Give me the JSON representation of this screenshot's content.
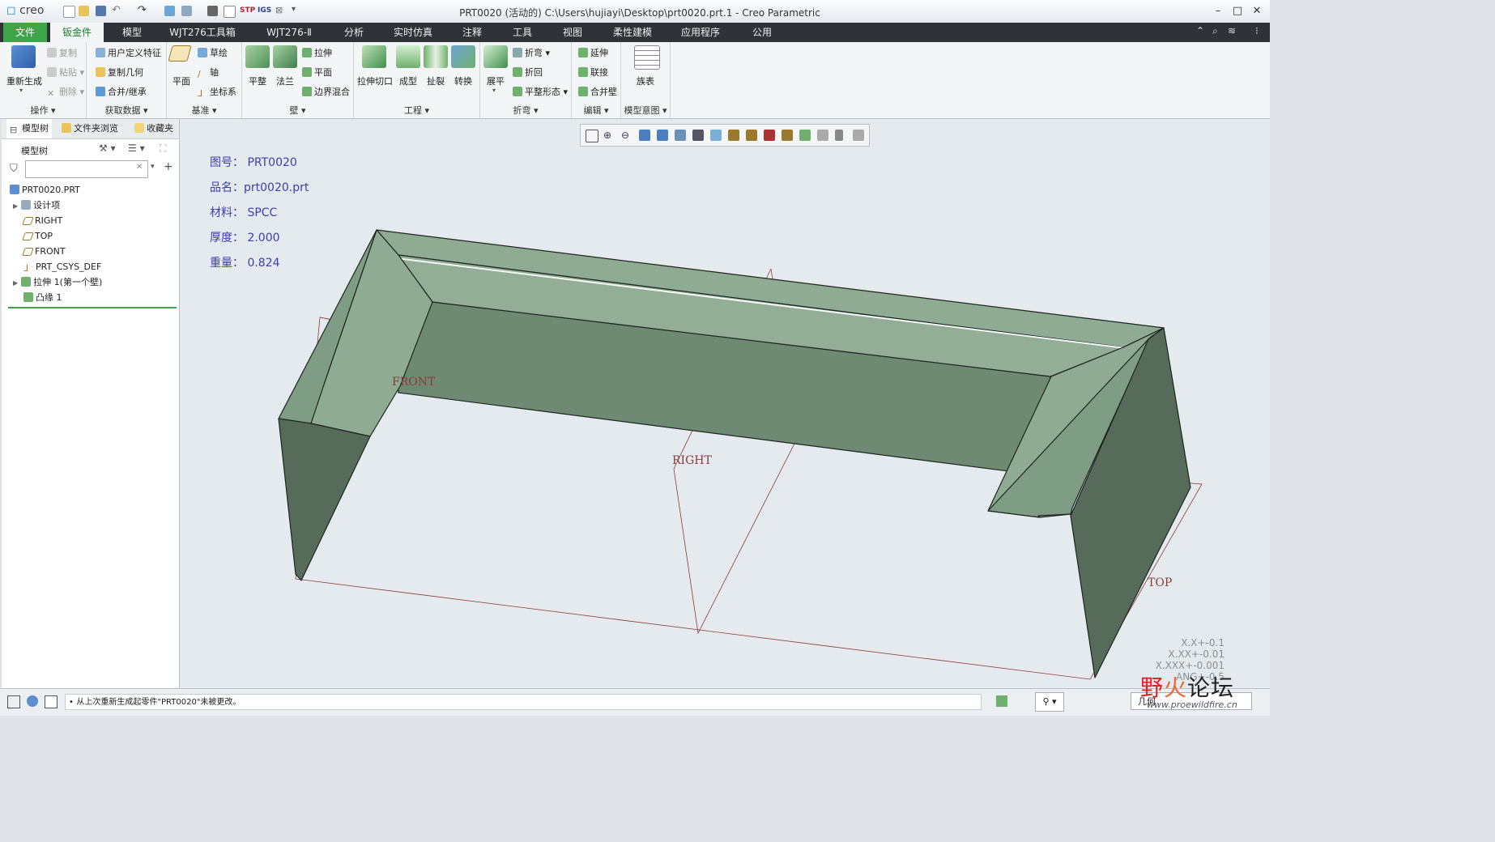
{
  "app": {
    "logo": "creo",
    "window_title": "PRT0020 (活动的) C:\\Users\\hujiayi\\Desktop\\prt0020.prt.1 - Creo Parametric"
  },
  "colors": {
    "accent": "#3ea549",
    "tab_dark": "#2f3338",
    "model_fill": "#8fab94",
    "model_dark": "#5a6e5f",
    "datum": "#8a3b3b",
    "note_text": "#3d3dab"
  },
  "tabs": [
    "文件",
    "钣金件",
    "模型",
    "WJT276工具箱",
    "WJT276-Ⅱ",
    "分析",
    "实时仿真",
    "注释",
    "工具",
    "视图",
    "柔性建模",
    "应用程序",
    "公用"
  ],
  "active_tab": "钣金件",
  "ribbon": {
    "groups": [
      {
        "label": "操作",
        "big": "重新生成",
        "small": [
          "复制",
          "粘贴",
          "删除"
        ]
      },
      {
        "label": "获取数据",
        "small": [
          "用户定义特征",
          "复制几何",
          "合并/继承"
        ]
      },
      {
        "label": "基准",
        "big": "平面",
        "small": [
          "草绘",
          "轴",
          "坐标系"
        ]
      },
      {
        "label": "壁",
        "bigs": [
          "平整",
          "法兰"
        ],
        "small": [
          "拉伸",
          "平面",
          "边界混合"
        ]
      },
      {
        "label": "工程",
        "bigs": [
          "拉伸切口",
          "成型",
          "扯裂",
          "转换"
        ]
      },
      {
        "label": "折弯",
        "big": "展平",
        "small": [
          "折弯",
          "折回",
          "平整形态"
        ]
      },
      {
        "label": "编辑",
        "small": [
          "延伸",
          "联接",
          "合并壁"
        ]
      },
      {
        "label": "模型意图",
        "big": "族表"
      }
    ]
  },
  "panel": {
    "tabs": [
      "模型树",
      "文件夹浏览器",
      "收藏夹"
    ],
    "tree_header": "模型树",
    "tree": [
      {
        "label": "PRT0020.PRT",
        "level": 0
      },
      {
        "label": "设计项",
        "level": 1
      },
      {
        "label": "RIGHT",
        "level": 1
      },
      {
        "label": "TOP",
        "level": 1
      },
      {
        "label": "FRONT",
        "level": 1
      },
      {
        "label": "PRT_CSYS_DEF",
        "level": 1
      },
      {
        "label": "拉伸 1(第一个壁)",
        "level": 1
      },
      {
        "label": "凸缘 1",
        "level": 1
      }
    ]
  },
  "notes": [
    {
      "label": "图号：",
      "value": "PRT0020"
    },
    {
      "label": "品名：",
      "value": "prt0020.prt"
    },
    {
      "label": "材料：",
      "value": "SPCC"
    },
    {
      "label": "厚度：",
      "value": "2.000"
    },
    {
      "label": "重量：",
      "value": "0.824"
    }
  ],
  "datum_labels": {
    "front": "FRONT",
    "right": "RIGHT",
    "top": "TOP"
  },
  "tolerances": [
    "X.X+-0.1",
    "X.XX+-0.01",
    "X.XXX+-0.001",
    "ANG+-0.5"
  ],
  "status": {
    "message": "从上次重新生成起零件\"PRT0020\"未被更改。",
    "filter": "几何"
  },
  "watermark": {
    "text": "野火论坛",
    "url": "www.proewildfire.cn"
  }
}
